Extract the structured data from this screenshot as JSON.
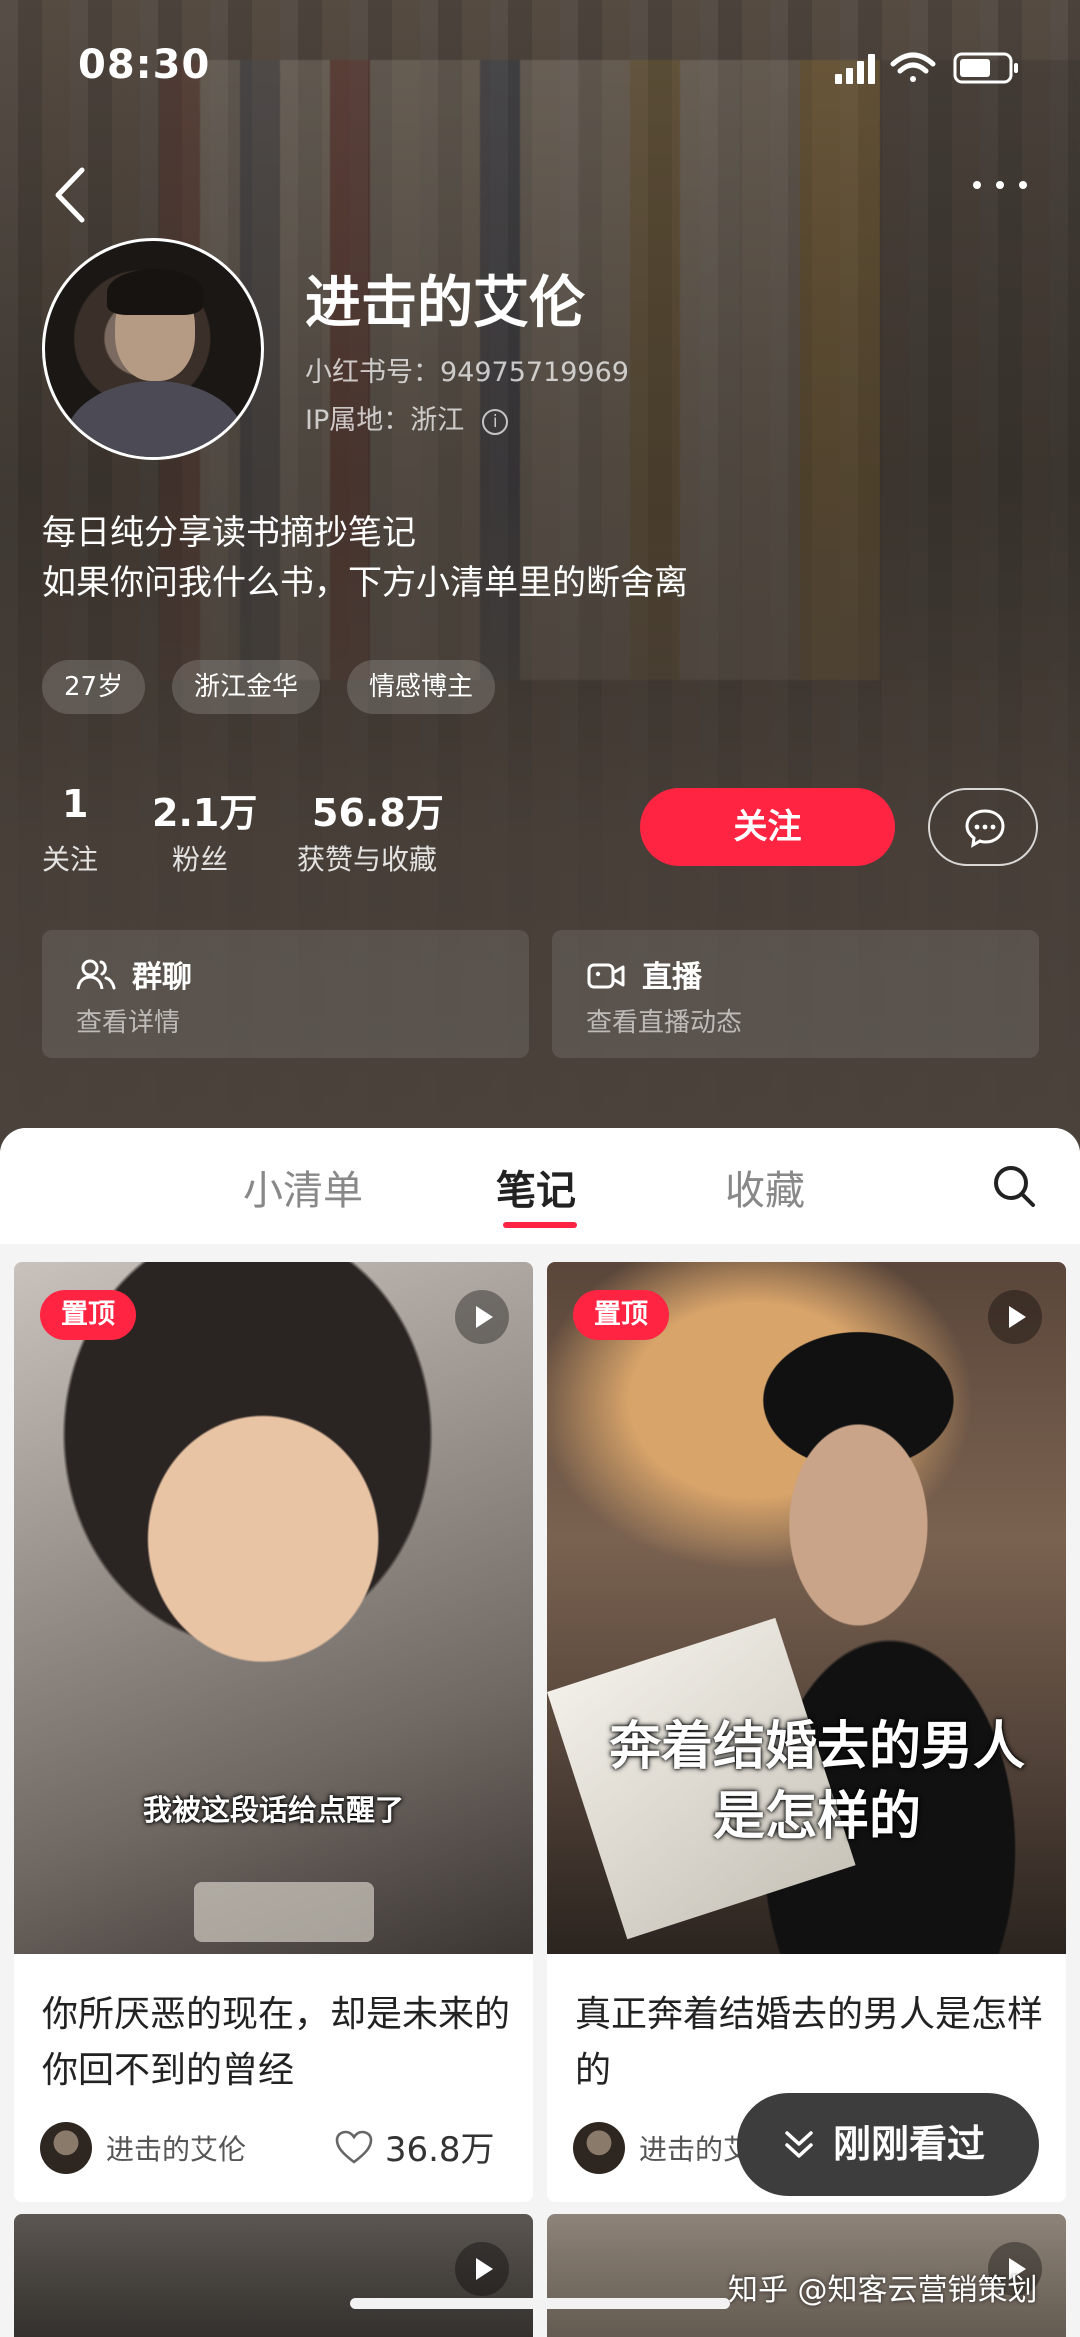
{
  "status_bar": {
    "time": "08:30"
  },
  "profile": {
    "nickname": "进击的艾伦",
    "redbook_id": "小红书号：94975719969",
    "ip_location": "IP属地：浙江",
    "bio_line1": "每日纯分享读书摘抄笔记",
    "bio_line2": "如果你问我什么书，下方小清单里的断舍离",
    "tags": [
      "27岁",
      "浙江金华",
      "情感博主"
    ],
    "stats": [
      {
        "value": "1",
        "label": "关注"
      },
      {
        "value": "2.1万",
        "label": "粉丝"
      },
      {
        "value": "56.8万",
        "label": "获赞与收藏"
      }
    ],
    "follow_label": "关注"
  },
  "cards": [
    {
      "title": "群聊",
      "subtitle": "查看详情",
      "icon": "group-chat-icon"
    },
    {
      "title": "直播",
      "subtitle": "查看直播动态",
      "icon": "live-camera-icon"
    }
  ],
  "tabs": [
    "小清单",
    "笔记",
    "收藏"
  ],
  "active_tab": "笔记",
  "posts": [
    {
      "pinned_label": "置顶",
      "caption": "我被这段话给点醒了",
      "title": "你所厌恶的现在，却是未来的你回不到的曾经",
      "author": "进击的艾伦",
      "likes": "36.8万"
    },
    {
      "pinned_label": "置顶",
      "caption": "奔着结婚去的男人是怎样的",
      "title": "真正奔着结婚去的男人是怎样的",
      "author": "进击的艾伦"
    }
  ],
  "recently_viewed_label": "刚刚看过",
  "watermark": "知乎 @知客云营销策划",
  "colors": {
    "accent": "#ff2442",
    "header_bg": "#4b433c",
    "sheet_bg": "#f4f4f4"
  }
}
